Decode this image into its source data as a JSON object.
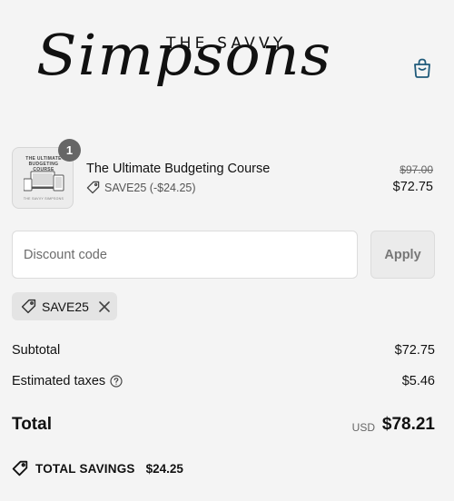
{
  "brand": {
    "top_text": "THE SAVVY",
    "script_text": "Simpsons"
  },
  "cart": {
    "icon": "shopping-bag-icon",
    "accent_color": "#1f5a7a"
  },
  "line_item": {
    "quantity": "1",
    "title": "The Ultimate Budgeting Course",
    "discount_text": "SAVE25 (-$24.25)",
    "original_price": "$97.00",
    "price": "$72.75",
    "thumbnail": {
      "title": "THE ULTIMATE BUDGETING COURSE",
      "footer": "THE SAVVY SIMPSONS"
    }
  },
  "discount": {
    "placeholder": "Discount code",
    "apply_label": "Apply",
    "applied_code": "SAVE25"
  },
  "summary": {
    "subtotal_label": "Subtotal",
    "subtotal_value": "$72.75",
    "taxes_label": "Estimated taxes",
    "taxes_value": "$5.46",
    "total_label": "Total",
    "currency": "USD",
    "total_value": "$78.21",
    "savings_label": "TOTAL SAVINGS",
    "savings_value": "$24.25"
  }
}
